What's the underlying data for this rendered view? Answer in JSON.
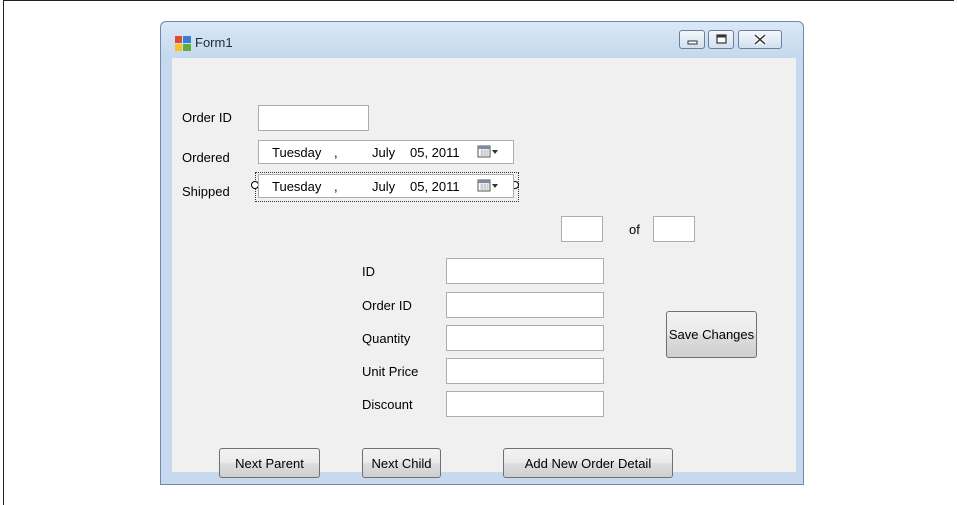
{
  "window": {
    "title": "Form1"
  },
  "parent": {
    "order_id_label": "Order ID",
    "order_id_value": "",
    "ordered_label": "Ordered",
    "ordered_date": {
      "day": "Tuesday",
      "sep": ",",
      "month": "July",
      "date": "05, 2011"
    },
    "shipped_label": "Shipped",
    "shipped_date": {
      "day": "Tuesday",
      "sep": ",",
      "month": "July",
      "date": "05, 2011"
    }
  },
  "navigator": {
    "position_value": "",
    "of_label": "of",
    "count_value": ""
  },
  "detail": {
    "fields": [
      {
        "label": "ID",
        "value": ""
      },
      {
        "label": "Order ID",
        "value": ""
      },
      {
        "label": "Quantity",
        "value": ""
      },
      {
        "label": "Unit Price",
        "value": ""
      },
      {
        "label": "Discount",
        "value": ""
      }
    ]
  },
  "buttons": {
    "save_changes": "Save Changes",
    "next_parent": "Next Parent",
    "next_child": "Next Child",
    "add_new_order_detail": "Add New Order Detail"
  }
}
